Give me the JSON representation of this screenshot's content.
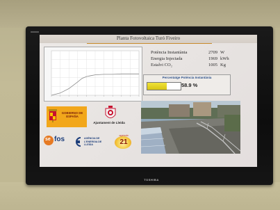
{
  "screen": {
    "title": "Planta Fotovoltaica Turó Fiveiro"
  },
  "metrics": [
    {
      "label": "Potència Instantània",
      "value": "2709",
      "unit": "W"
    },
    {
      "label": "Energia Injectada",
      "value": "1969",
      "unit": "kWh"
    },
    {
      "label": "Estalvi CO₂",
      "value": "1005",
      "unit": "Kg"
    }
  ],
  "percentage": {
    "title": "Percentatge Potència Instantània",
    "value_label": "58.9 %",
    "fraction": 0.589
  },
  "logos": {
    "spain_text": "GOBIERNO DE ESPAÑA",
    "lleida_text": "Ajuntament de Lleida",
    "sefos_prefix": "se",
    "sefos_suffix": "fos",
    "agencia_text": "AGÈNCIA DE L'ENERGIA DE LLEIDA",
    "agenda_word": "agenda",
    "agenda_num": "21"
  },
  "tv": {
    "brand": "TOSHIBA"
  },
  "colors": {
    "accent": "#c88a2a",
    "bar_fill": "#e4d22a",
    "spain_logo_bg": "#f2a71b",
    "screen_bg": "#e8e4e1",
    "pct_title": "#2b4f8a"
  },
  "chart_data": {
    "type": "line",
    "series": [
      {
        "x": [
          0,
          0.1,
          0.2,
          0.3,
          0.35,
          0.4,
          0.45,
          0.5,
          0.6,
          0.7,
          0.8,
          0.9,
          1.0
        ],
        "values": [
          0,
          0.05,
          0.15,
          0.3,
          0.38,
          0.42,
          0.44,
          0.46,
          0.47,
          0.47,
          0.48,
          0.48,
          0.48
        ]
      }
    ],
    "grid": true
  }
}
